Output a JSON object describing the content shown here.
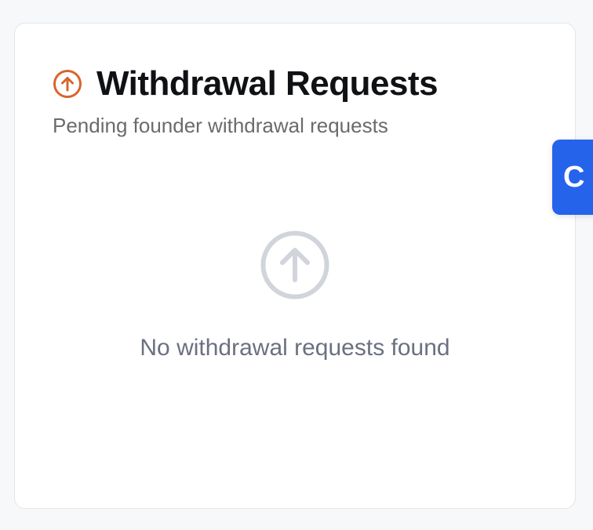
{
  "card": {
    "title": "Withdrawal Requests",
    "subtitle": "Pending founder withdrawal requests",
    "title_icon": "arrow-up-circle-icon",
    "title_icon_color": "#d9642c"
  },
  "empty_state": {
    "icon": "arrow-up-circle-icon",
    "icon_color": "#d1d4db",
    "message": "No withdrawal requests found"
  },
  "side_tab": {
    "label": "C",
    "color": "#2563eb"
  }
}
